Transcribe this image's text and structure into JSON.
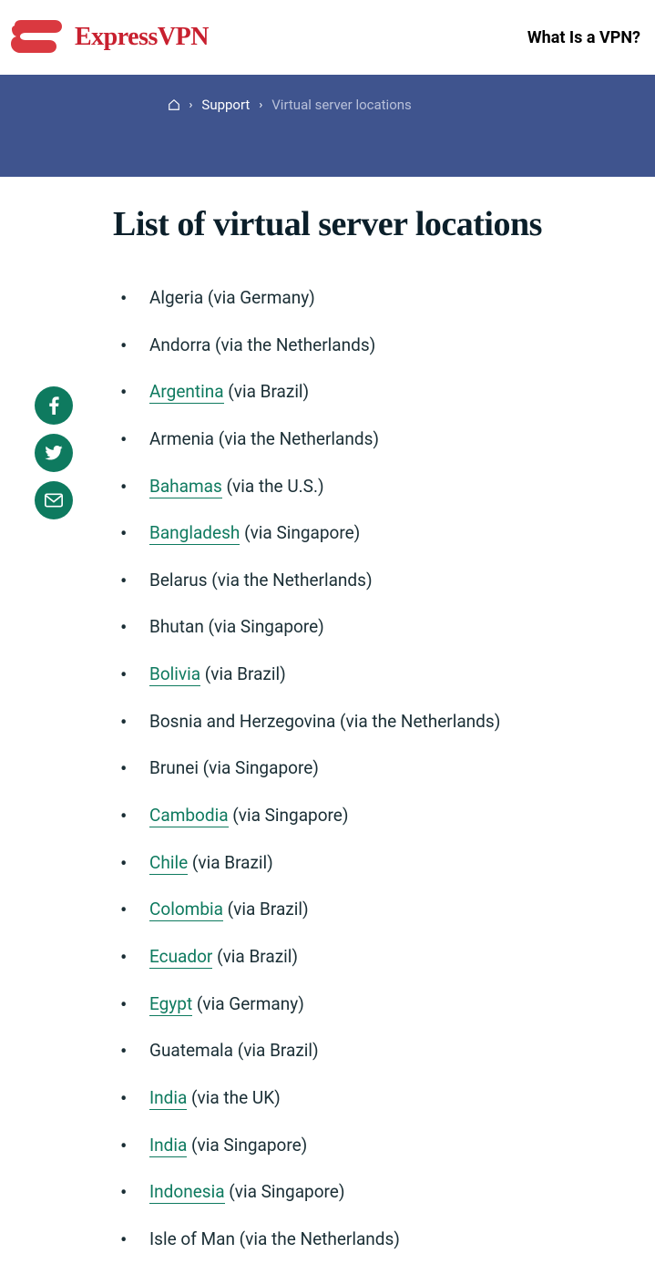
{
  "header": {
    "brand_name": "ExpressVPN",
    "nav_link": "What Is a VPN?"
  },
  "breadcrumb": {
    "support": "Support",
    "current": "Virtual server locations"
  },
  "page": {
    "title": "List of virtual server locations"
  },
  "social": {
    "facebook": "facebook-icon",
    "twitter": "twitter-icon",
    "email": "email-icon"
  },
  "locations": [
    {
      "country": "Algeria",
      "link": false,
      "via": " (via Germany)"
    },
    {
      "country": "Andorra",
      "link": false,
      "via": " (via the Netherlands)"
    },
    {
      "country": "Argentina",
      "link": true,
      "via": " (via Brazil)"
    },
    {
      "country": "Armenia",
      "link": false,
      "via": " (via the Netherlands)"
    },
    {
      "country": "Bahamas",
      "link": true,
      "via": " (via the U.S.)"
    },
    {
      "country": "Bangladesh",
      "link": true,
      "via": " (via Singapore)"
    },
    {
      "country": "Belarus",
      "link": false,
      "via": " (via the Netherlands)"
    },
    {
      "country": "Bhutan",
      "link": false,
      "via": " (via Singapore)"
    },
    {
      "country": "Bolivia",
      "link": true,
      "via": " (via Brazil)"
    },
    {
      "country": "Bosnia and Herzegovina",
      "link": false,
      "via": " (via the Netherlands)"
    },
    {
      "country": "Brunei",
      "link": false,
      "via": " (via Singapore)"
    },
    {
      "country": "Cambodia",
      "link": true,
      "via": " (via Singapore)"
    },
    {
      "country": "Chile",
      "link": true,
      "via": " (via Brazil)"
    },
    {
      "country": "Colombia",
      "link": true,
      "via": " (via Brazil)"
    },
    {
      "country": "Ecuador",
      "link": true,
      "via": " (via Brazil)"
    },
    {
      "country": "Egypt",
      "link": true,
      "via": " (via Germany)"
    },
    {
      "country": "Guatemala",
      "link": false,
      "via": " (via Brazil)"
    },
    {
      "country": "India",
      "link": true,
      "via": " (via the UK)"
    },
    {
      "country": "India",
      "link": true,
      "via": " (via Singapore)"
    },
    {
      "country": "Indonesia",
      "link": true,
      "via": " (via Singapore)"
    },
    {
      "country": "Isle of Man",
      "link": false,
      "via": " (via the Netherlands)"
    }
  ]
}
